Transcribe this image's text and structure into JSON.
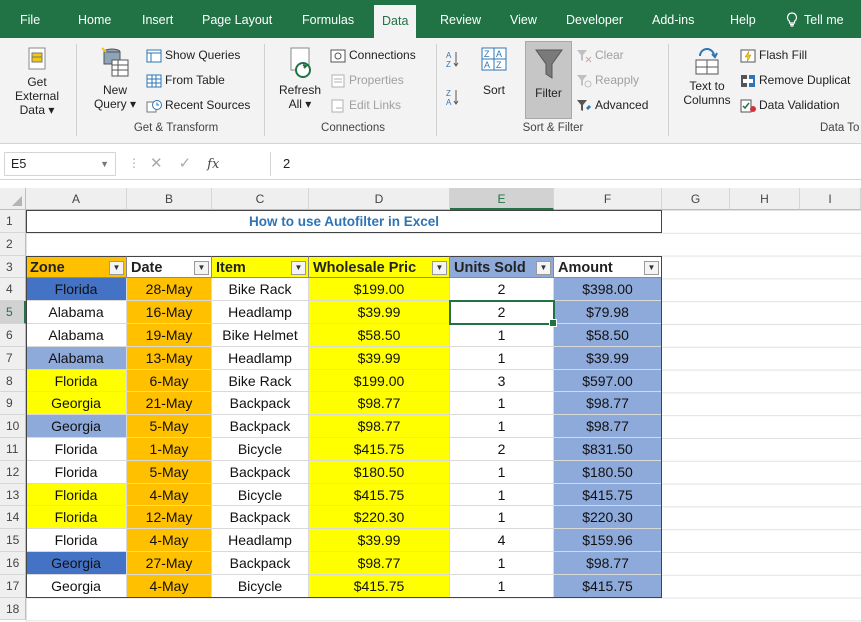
{
  "tabs": [
    "File",
    "Home",
    "Insert",
    "Page Layout",
    "Formulas",
    "Data",
    "Review",
    "View",
    "Developer",
    "Add-ins",
    "Help"
  ],
  "active_tab": "Data",
  "tell_me": "Tell me",
  "ribbon": {
    "get_external_data": [
      "Get External",
      "Data ▾"
    ],
    "new_query": [
      "New",
      "Query ▾"
    ],
    "show_queries": "Show Queries",
    "from_table": "From Table",
    "recent_sources": "Recent Sources",
    "get_transform_label": "Get & Transform",
    "refresh_all": [
      "Refresh",
      "All ▾"
    ],
    "connections": "Connections",
    "properties": "Properties",
    "edit_links": "Edit Links",
    "connections_label": "Connections",
    "sort": "Sort",
    "filter": "Filter",
    "clear": "Clear",
    "reapply": "Reapply",
    "advanced": "Advanced",
    "sort_filter_label": "Sort & Filter",
    "text_to_columns": [
      "Text to",
      "Columns"
    ],
    "flash_fill": "Flash Fill",
    "remove_duplicates": "Remove Duplicat",
    "data_validation": "Data Validation",
    "data_tools_label": "Data To"
  },
  "formula_bar": {
    "name_box": "E5",
    "fx": "fx",
    "value": "2"
  },
  "columns": [
    "A",
    "B",
    "C",
    "D",
    "E",
    "F",
    "G",
    "H",
    "I"
  ],
  "selected_column": "E",
  "rows": [
    "1",
    "2",
    "3",
    "4",
    "5",
    "6",
    "7",
    "8",
    "9",
    "10",
    "11",
    "12",
    "13",
    "14",
    "15",
    "16",
    "17",
    "18"
  ],
  "selected_row": "5",
  "title": "How to use Autofilter in Excel",
  "headers": [
    "Zone",
    "Date",
    "Item",
    "Wholesale Pric",
    "Units Sold",
    "Amount"
  ],
  "colors": {
    "ribbon_green": "#217346",
    "yellow": "#ffff00",
    "orange": "#ffc000",
    "light_blue": "#8eaadb",
    "blue": "#4472c4",
    "title_blue": "#2e74b5"
  },
  "table": [
    {
      "zone": "Florida",
      "date": "28-May",
      "item": "Bike Rack",
      "price": "$199.00",
      "units": "2",
      "amount": "$398.00",
      "zone_fill": "#4472c4"
    },
    {
      "zone": "Alabama",
      "date": "16-May",
      "item": "Headlamp",
      "price": "$39.99",
      "units": "2",
      "amount": "$79.98",
      "zone_fill": "#ffffff"
    },
    {
      "zone": "Alabama",
      "date": "19-May",
      "item": "Bike Helmet",
      "price": "$58.50",
      "units": "1",
      "amount": "$58.50",
      "zone_fill": "#ffffff"
    },
    {
      "zone": "Alabama",
      "date": "13-May",
      "item": "Headlamp",
      "price": "$39.99",
      "units": "1",
      "amount": "$39.99",
      "zone_fill": "#8eaadb"
    },
    {
      "zone": "Florida",
      "date": "6-May",
      "item": "Bike Rack",
      "price": "$199.00",
      "units": "3",
      "amount": "$597.00",
      "zone_fill": "#ffff00"
    },
    {
      "zone": "Georgia",
      "date": "21-May",
      "item": "Backpack",
      "price": "$98.77",
      "units": "1",
      "amount": "$98.77",
      "zone_fill": "#ffff00"
    },
    {
      "zone": "Georgia",
      "date": "5-May",
      "item": "Backpack",
      "price": "$98.77",
      "units": "1",
      "amount": "$98.77",
      "zone_fill": "#8eaadb"
    },
    {
      "zone": "Florida",
      "date": "1-May",
      "item": "Bicycle",
      "price": "$415.75",
      "units": "2",
      "amount": "$831.50",
      "zone_fill": "#ffffff"
    },
    {
      "zone": "Florida",
      "date": "5-May",
      "item": "Backpack",
      "price": "$180.50",
      "units": "1",
      "amount": "$180.50",
      "zone_fill": "#ffffff"
    },
    {
      "zone": "Florida",
      "date": "4-May",
      "item": "Bicycle",
      "price": "$415.75",
      "units": "1",
      "amount": "$415.75",
      "zone_fill": "#ffff00"
    },
    {
      "zone": "Florida",
      "date": "12-May",
      "item": "Backpack",
      "price": "$220.30",
      "units": "1",
      "amount": "$220.30",
      "zone_fill": "#ffff00"
    },
    {
      "zone": "Florida",
      "date": "4-May",
      "item": "Headlamp",
      "price": "$39.99",
      "units": "4",
      "amount": "$159.96",
      "zone_fill": "#ffffff"
    },
    {
      "zone": "Georgia",
      "date": "27-May",
      "item": "Backpack",
      "price": "$98.77",
      "units": "1",
      "amount": "$98.77",
      "zone_fill": "#4472c4"
    },
    {
      "zone": "Georgia",
      "date": "4-May",
      "item": "Bicycle",
      "price": "$415.75",
      "units": "1",
      "amount": "$415.75",
      "zone_fill": "#ffffff"
    }
  ]
}
